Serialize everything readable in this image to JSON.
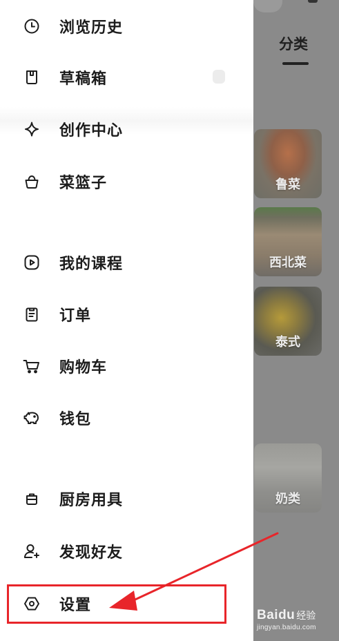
{
  "drawer": {
    "items": [
      {
        "label": "浏览历史",
        "icon": "clock-icon"
      },
      {
        "label": "草稿箱",
        "icon": "draft-icon"
      },
      {
        "label": "创作中心",
        "icon": "sparkle-icon"
      },
      {
        "label": "菜篮子",
        "icon": "basket-icon"
      },
      {
        "label": "我的课程",
        "icon": "play-icon"
      },
      {
        "label": "订单",
        "icon": "clipboard-icon"
      },
      {
        "label": "购物车",
        "icon": "cart-icon"
      },
      {
        "label": "钱包",
        "icon": "piggy-bank-icon"
      },
      {
        "label": "厨房用具",
        "icon": "pot-icon"
      },
      {
        "label": "发现好友",
        "icon": "add-friend-icon"
      },
      {
        "label": "设置",
        "icon": "settings-icon"
      }
    ]
  },
  "background": {
    "tab_label": "分类",
    "categories": [
      {
        "label": "鲁菜"
      },
      {
        "label": "西北菜"
      },
      {
        "label": "泰式"
      },
      {
        "label": "奶类"
      }
    ]
  },
  "annotation": {
    "highlight_color": "#e8252a"
  },
  "watermark": {
    "brand": "Baidu",
    "sub": "经验",
    "url": "jingyan.baidu.com"
  }
}
